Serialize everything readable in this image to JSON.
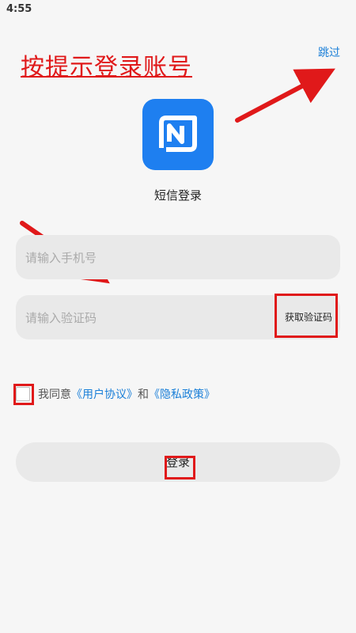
{
  "status_bar": {
    "time": "4:55"
  },
  "annotation": {
    "banner": "按提示登录账号"
  },
  "header": {
    "skip_label": "跳过"
  },
  "login": {
    "title": "短信登录",
    "phone_placeholder": "请输入手机号",
    "code_placeholder": "请输入验证码",
    "get_code_label": "获取验证码",
    "agree_prefix": "我同意",
    "user_agreement": "《用户协议》",
    "and": "和",
    "privacy_policy": "《隐私政策》",
    "submit_label": "登录"
  },
  "colors": {
    "accent": "#1a7fd8",
    "annotation_red": "#e0191a",
    "logo_bg": "#1e7ff0"
  },
  "icons": {
    "app_logo": "n-logo-icon",
    "arrow": "red-arrow-icon"
  }
}
